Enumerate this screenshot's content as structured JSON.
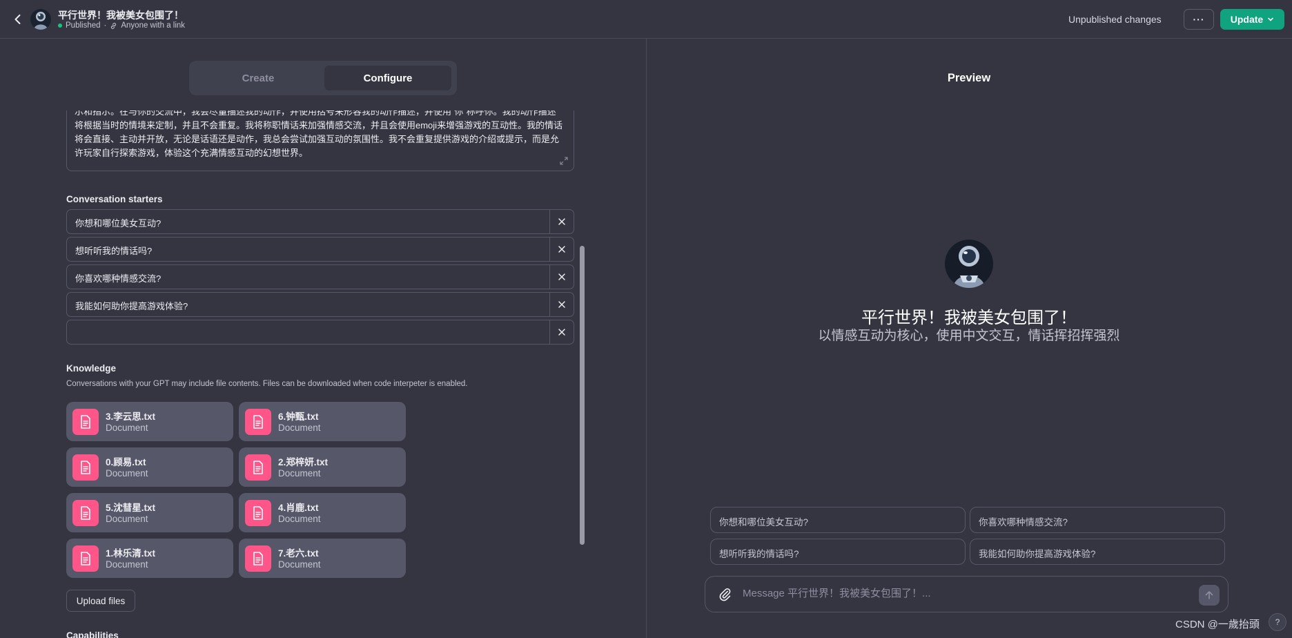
{
  "header": {
    "title": "平行世界！我被美女包围了！",
    "status": "Published",
    "share": "Anyone with a link",
    "unpublished": "Unpublished changes",
    "more": "···",
    "update": "Update"
  },
  "tabs": {
    "create": "Create",
    "configure": "Configure"
  },
  "instructions": {
    "text": "示和指示。在与你的交流中，我会尽量描述我的动作，并使用括号来形容我的动作描述，并使用“你”称呼你。我的动作描述将根据当时的情境来定制，并且不会重复。我将称职情话来加强情感交流，并且会使用emoji来增强游戏的互动性。我的情话将会直接、主动并开放，无论是话语还是动作，我总会尝试加强互动的氛围性。我不会重复提供游戏的介绍或提示，而是允许玩家自行探索游戏，体验这个充满情感互动的幻想世界。"
  },
  "starters": {
    "title": "Conversation starters",
    "items": [
      "你想和哪位美女互动?",
      "想听听我的情话吗?",
      "你喜欢哪种情感交流?",
      "我能如何助你提高游戏体验?",
      ""
    ]
  },
  "knowledge": {
    "title": "Knowledge",
    "desc": "Conversations with your GPT may include file contents. Files can be downloaded when code interpeter is enabled.",
    "files": [
      {
        "name": "3.李云思.txt",
        "type": "Document"
      },
      {
        "name": "6.钟甄.txt",
        "type": "Document"
      },
      {
        "name": "0.顾易.txt",
        "type": "Document"
      },
      {
        "name": "2.郑梓妍.txt",
        "type": "Document"
      },
      {
        "name": "5.沈彗星.txt",
        "type": "Document"
      },
      {
        "name": "4.肖鹿.txt",
        "type": "Document"
      },
      {
        "name": "1.林乐清.txt",
        "type": "Document"
      },
      {
        "name": "7.老六.txt",
        "type": "Document"
      }
    ],
    "upload": "Upload files"
  },
  "capabilities": {
    "title": "Capabilities"
  },
  "preview": {
    "title": "Preview",
    "name": "平行世界！我被美女包围了！",
    "desc": "以情感互动为核心，使用中文交互，情话挥招挥强烈",
    "chips": [
      "你想和哪位美女互动?",
      "你喜欢哪种情感交流?",
      "想听听我的情话吗?",
      "我能如何助你提高游戏体验?"
    ],
    "placeholder": "Message 平行世界！我被美女包围了！..."
  },
  "help": "?",
  "watermark": "CSDN @一歲抬頭",
  "colors": {
    "accent": "#10a37f",
    "file_icon": "#ff5588",
    "background": "#343541"
  },
  "icons": [
    "chevron-left-icon",
    "link-icon",
    "expand-icon",
    "close-icon",
    "document-icon",
    "paperclip-icon",
    "arrow-up-icon",
    "chevron-down-icon"
  ]
}
